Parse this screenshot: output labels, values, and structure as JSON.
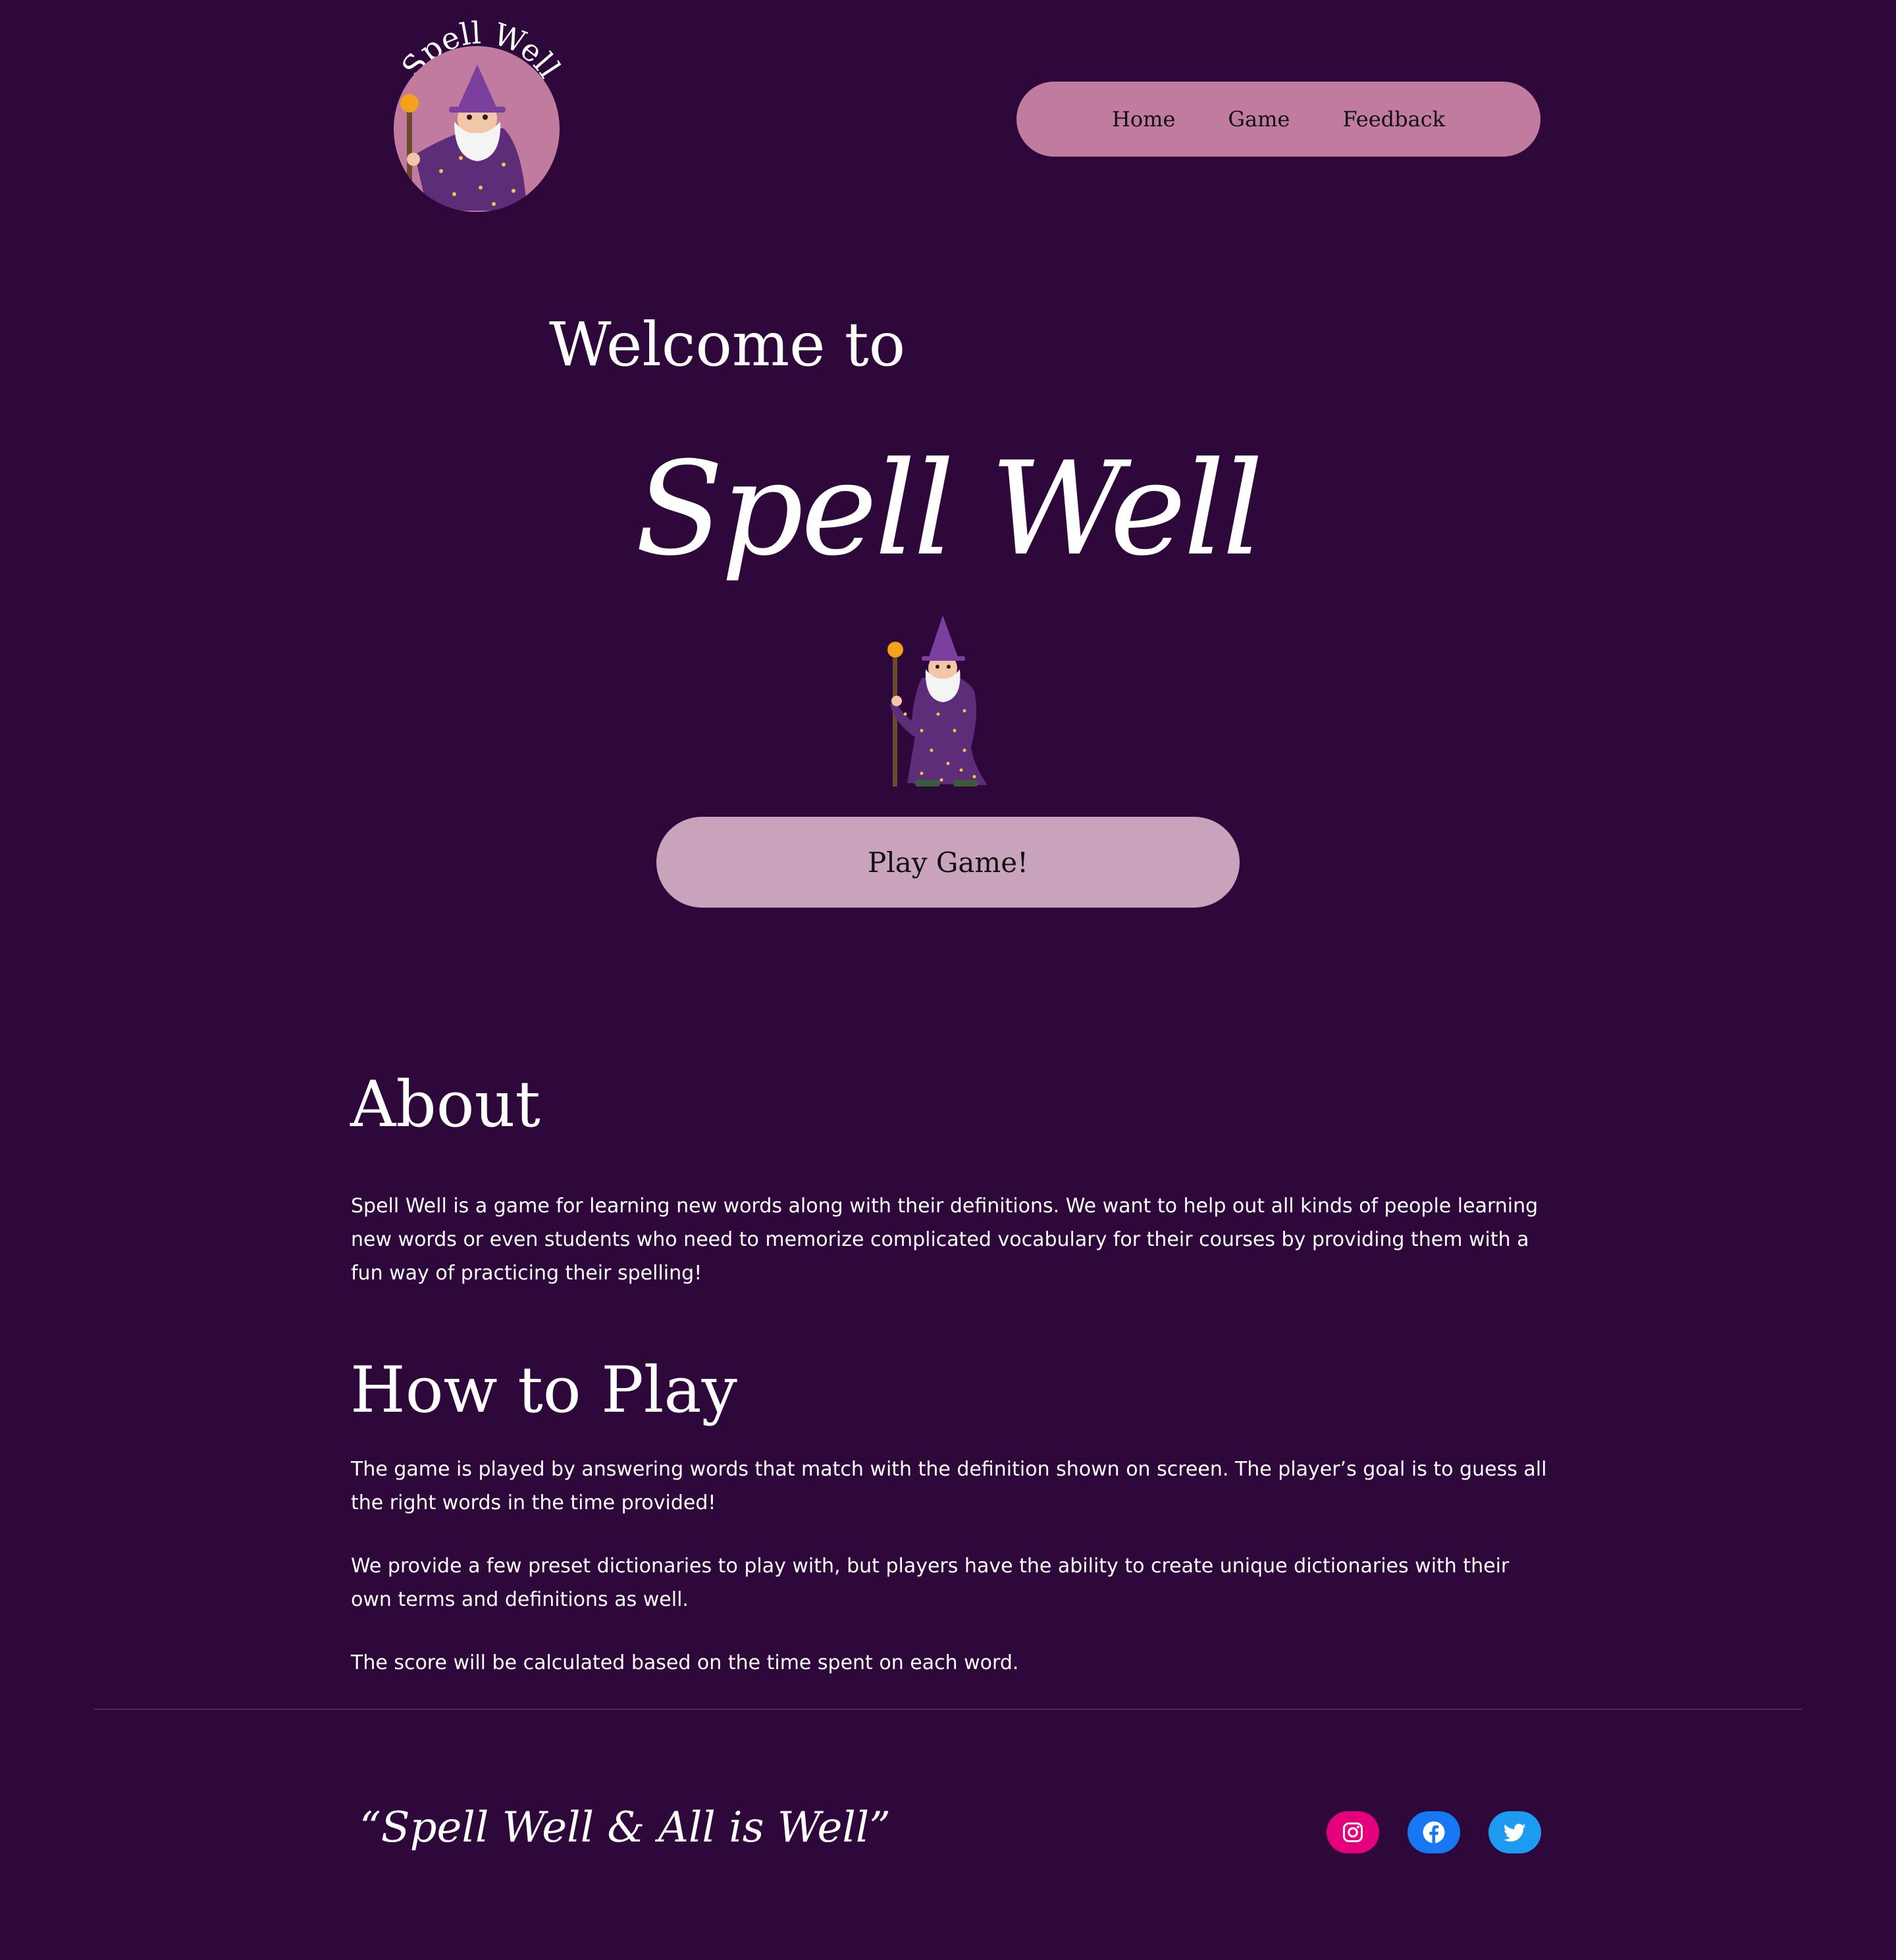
{
  "header": {
    "logo_text": "Spell Well",
    "nav": [
      {
        "label": "Home"
      },
      {
        "label": "Game"
      },
      {
        "label": "Feedback"
      }
    ]
  },
  "hero": {
    "welcome": "Welcome to",
    "brand": "Spell Well",
    "play_button": "Play Game!"
  },
  "about": {
    "heading": "About",
    "body": "Spell Well is a game for learning new words along with their definitions. We want to help out all kinds of people learning new words or even students who need to memorize complicated vocabulary for their courses by providing them with a fun way of practicing their spelling!"
  },
  "how_to_play": {
    "heading": "How to Play",
    "paragraphs": [
      "The game is played by answering words that match with the definition shown on screen. The player’s goal is to guess all the right words in the time provided!",
      "We provide a few preset dictionaries to play with, but players have the ability to create unique dictionaries with their own terms and definitions as well.",
      "The score will be calculated based on the time spent on each word."
    ]
  },
  "footer": {
    "tagline": "“Spell Well & All is Well”",
    "social": [
      {
        "icon": "instagram-icon",
        "color": "#e4007c"
      },
      {
        "icon": "facebook-icon",
        "color": "#1877f2"
      },
      {
        "icon": "twitter-icon",
        "color": "#1d9bf0"
      }
    ]
  },
  "colors": {
    "background": "#2e073b",
    "nav_pill": "#c17b9f",
    "play_button": "#c9a3bc",
    "logo_circle": "#c17b9f",
    "wizard_robe": "#5e2d79",
    "wizard_hat": "#7b3f9e",
    "staff_orb": "#f5a11a"
  }
}
